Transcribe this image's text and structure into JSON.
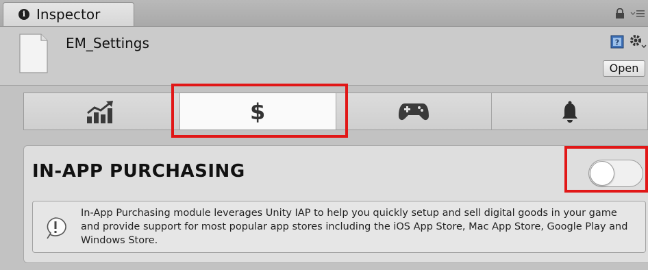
{
  "window": {
    "tab_label": "Inspector"
  },
  "header": {
    "asset_name": "EM_Settings",
    "open_label": "Open"
  },
  "module_tabs": [
    {
      "icon": "chart-icon",
      "active": false
    },
    {
      "label": "$",
      "icon": "dollar-icon",
      "active": true
    },
    {
      "icon": "gamepad-icon",
      "active": false
    },
    {
      "icon": "bell-icon",
      "active": false
    }
  ],
  "panel": {
    "title": "IN-APP PURCHASING",
    "toggle_on": false,
    "help_text": "In-App Purchasing module leverages Unity IAP to help you quickly setup and sell digital goods in your game and provide support for most popular app stores including the iOS App Store, Mac App Store, Google Play and Windows Store."
  },
  "colors": {
    "highlight": "#e11717",
    "background": "#c2c2c2",
    "panel": "#dedede"
  }
}
